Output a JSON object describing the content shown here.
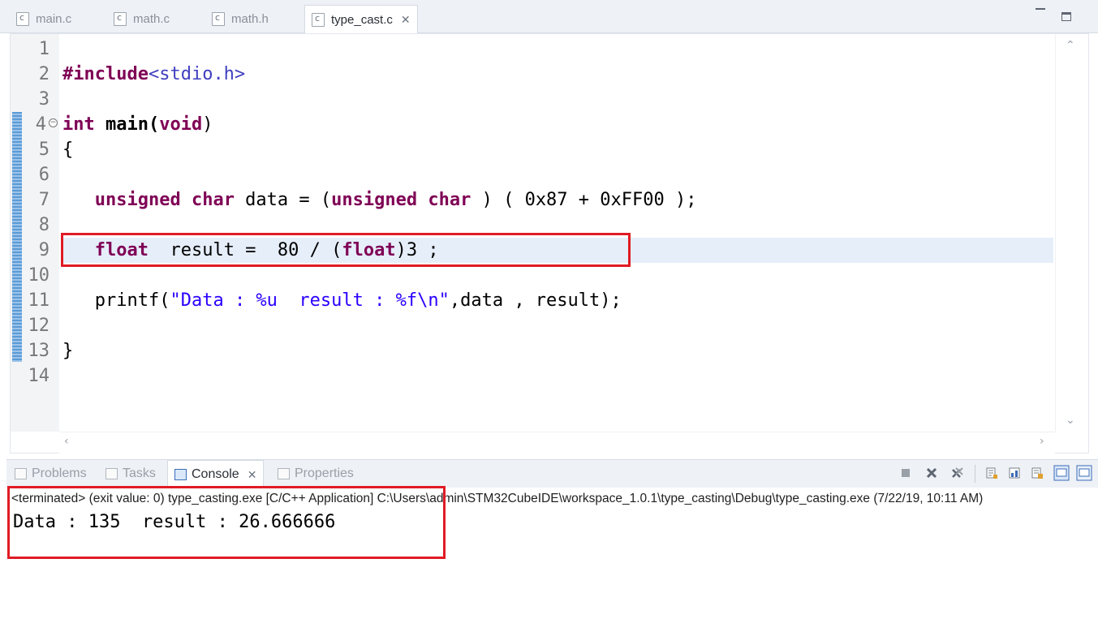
{
  "editor_tabs": [
    {
      "label": "main.c",
      "active": false
    },
    {
      "label": "math.c",
      "active": false
    },
    {
      "label": "math.h",
      "active": false
    },
    {
      "label": "type_cast.c",
      "active": true
    }
  ],
  "code": {
    "line_numbers": [
      "1",
      "2",
      "3",
      "4",
      "5",
      "6",
      "7",
      "8",
      "9",
      "10",
      "11",
      "12",
      "13",
      "14"
    ],
    "line2": {
      "kw": "#include",
      "inc": "<stdio.h>"
    },
    "line4": {
      "kw1": "int",
      "name": " main(",
      "kw2": "void",
      "tail": ")"
    },
    "line5": "{",
    "line7": {
      "indent": "   ",
      "kw1": "unsigned char",
      "mid1": " data = (",
      "kw2": "unsigned char",
      "tail": " ) ( 0x87 + 0xFF00 );"
    },
    "line9": {
      "indent": "   ",
      "kw1": "float",
      "mid": "  result =  80 / (",
      "kw2": "float",
      "tail": ")3 ;"
    },
    "line11": {
      "indent": "   ",
      "fn": "printf(",
      "str": "\"Data : %u  result : %f\\n\"",
      "tail": ",data , result);"
    },
    "line13": "}"
  },
  "view_tabs": [
    {
      "label": "Problems",
      "icon": "problems-icon",
      "active": false
    },
    {
      "label": "Tasks",
      "icon": "tasks-icon",
      "active": false
    },
    {
      "label": "Console",
      "icon": "console-icon",
      "active": true
    },
    {
      "label": "Properties",
      "icon": "properties-icon",
      "active": false
    }
  ],
  "console": {
    "status": "<terminated> (exit value: 0) type_casting.exe [C/C++ Application] C:\\Users\\admin\\STM32CubeIDE\\workspace_1.0.1\\type_casting\\Debug\\type_casting.exe (7/22/19, 10:11 AM)",
    "output": "Data : 135  result : 26.666666"
  },
  "colors": {
    "keyword": "#7f0055",
    "include_path": "#3f3fbf",
    "string": "#2a00ff",
    "callout_red": "#e01b24",
    "current_line": "#e6eefa"
  },
  "toolbar_icons": [
    "terminate-icon",
    "remove-launch-icon",
    "remove-all-terminated-icon",
    "scroll-lock-icon",
    "show-on-stdout-icon",
    "show-on-stderr-icon",
    "display-selected-console-icon",
    "open-console-icon"
  ]
}
